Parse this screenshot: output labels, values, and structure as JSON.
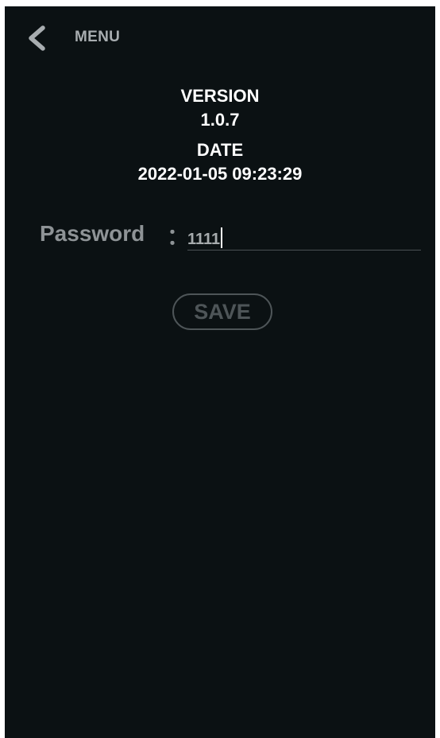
{
  "header": {
    "back_icon": "chevron-left-icon",
    "menu_label": "MENU"
  },
  "info": {
    "version_label": "VERSION",
    "version_value": "1.0.7",
    "date_label": "DATE",
    "date_value": "2022-01-05 09:23:29"
  },
  "password": {
    "label": "Password",
    "colon": "：",
    "value": "1111"
  },
  "actions": {
    "save_label": "SAVE"
  },
  "colors": {
    "background": "#0b1113",
    "text_primary": "#ffffff",
    "text_muted": "#8e9396",
    "button_disabled": "#4e5558"
  }
}
